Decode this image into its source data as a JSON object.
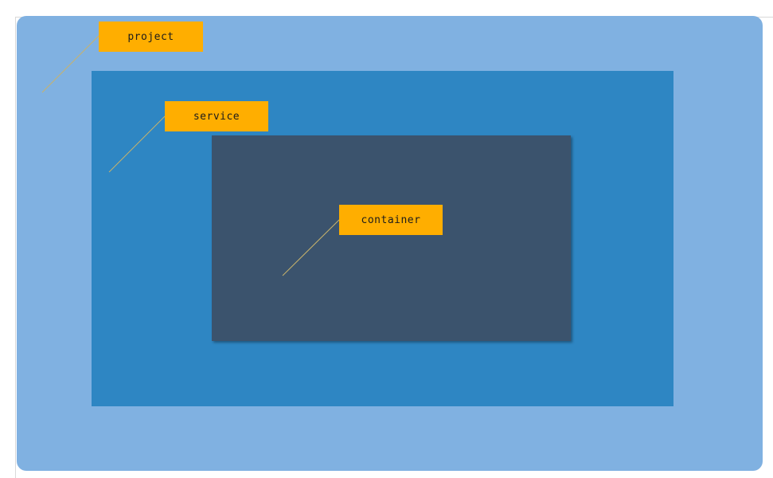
{
  "diagram": {
    "project": {
      "label": "project",
      "color": "#80b1e1"
    },
    "service": {
      "label": "service",
      "color": "#2e86c3"
    },
    "container": {
      "label": "container",
      "color": "#3b536d"
    },
    "callout_color": "#ffae00",
    "leader_line_color": "#c7b36c"
  }
}
